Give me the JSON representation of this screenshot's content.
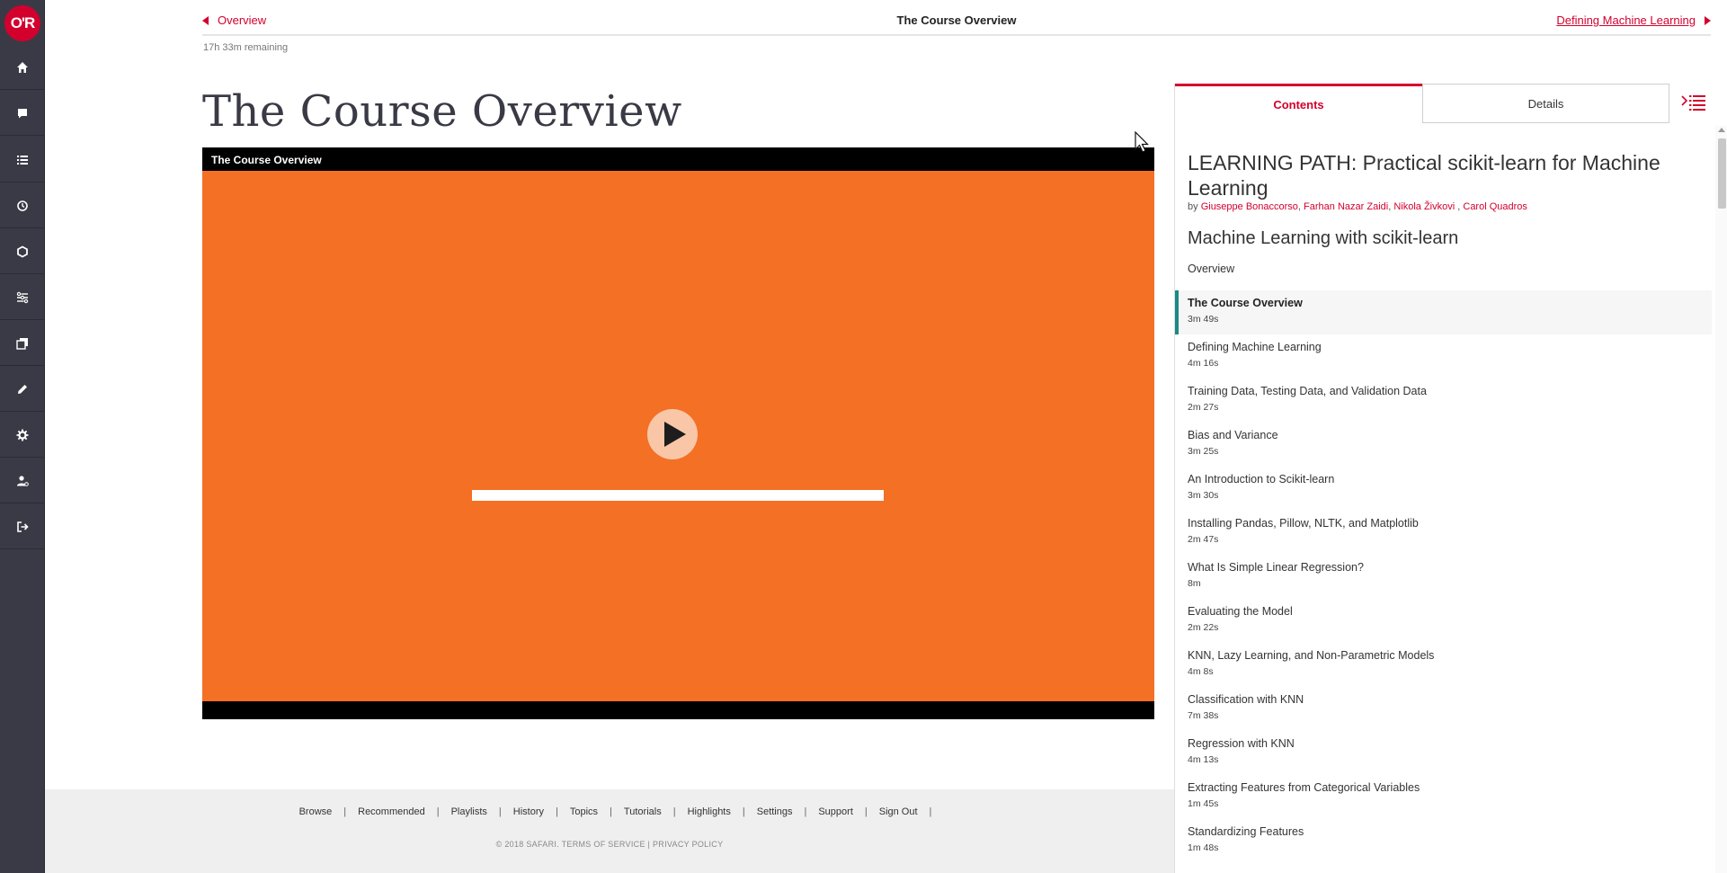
{
  "app": {
    "logo_text": "O'R",
    "brand_color": "#d3002d",
    "accent_color": "#1a8a83",
    "video_bg_color": "#f37024"
  },
  "sidebar": {
    "items": [
      {
        "name": "home",
        "icon": "home-icon"
      },
      {
        "name": "recommended",
        "icon": "chat-icon"
      },
      {
        "name": "playlists",
        "icon": "list-icon"
      },
      {
        "name": "history",
        "icon": "history-icon"
      },
      {
        "name": "topics",
        "icon": "hexagon-icon"
      },
      {
        "name": "tutorials",
        "icon": "tutorials-icon"
      },
      {
        "name": "highlights",
        "icon": "copy-icon"
      },
      {
        "name": "notes",
        "icon": "pencil-icon"
      },
      {
        "name": "settings",
        "icon": "gear-icon"
      },
      {
        "name": "account",
        "icon": "user-icon"
      },
      {
        "name": "sign-out",
        "icon": "sign-out-icon"
      }
    ]
  },
  "topbar": {
    "prev_label": "Overview",
    "title": "The Course Overview",
    "next_label": "Defining Machine Learning"
  },
  "remaining": "17h 33m remaining",
  "page_title": "The Course Overview",
  "video": {
    "title": "The Course Overview",
    "play_icon": "play-icon",
    "progress": 0
  },
  "footer": {
    "links": [
      "Browse",
      "Recommended",
      "Playlists",
      "History",
      "Topics",
      "Tutorials",
      "Highlights",
      "Settings",
      "Support",
      "Sign Out"
    ],
    "copyright": "© 2018 SAFARI. TERMS OF SERVICE | PRIVACY POLICY"
  },
  "panel": {
    "tabs": {
      "contents": "Contents",
      "details": "Details"
    },
    "toc_icon": "toc-icon",
    "path_title": "LEARNING PATH: Practical scikit-learn for Machine Learning",
    "by_label": "by",
    "authors": [
      "Giuseppe Bonaccorso",
      "Farhan Nazar Zaidi",
      "Nikola Živkovi",
      "Carol Quadros"
    ],
    "course_title": "Machine Learning with scikit-learn",
    "overview_label": "Overview",
    "lessons": [
      {
        "title": "The Course Overview",
        "duration": "3m 49s",
        "active": true
      },
      {
        "title": "Defining Machine Learning",
        "duration": "4m 16s"
      },
      {
        "title": "Training Data, Testing Data, and Validation Data",
        "duration": "2m 27s"
      },
      {
        "title": "Bias and Variance",
        "duration": "3m 25s"
      },
      {
        "title": "An Introduction to Scikit-learn",
        "duration": "3m 30s"
      },
      {
        "title": "Installing Pandas, Pillow, NLTK, and Matplotlib",
        "duration": "2m 47s"
      },
      {
        "title": "What Is Simple Linear Regression?",
        "duration": "8m"
      },
      {
        "title": "Evaluating the Model",
        "duration": "2m 22s"
      },
      {
        "title": "KNN, Lazy Learning, and Non-Parametric Models",
        "duration": "4m 8s"
      },
      {
        "title": "Classification with KNN",
        "duration": "7m 38s"
      },
      {
        "title": "Regression with KNN",
        "duration": "4m 13s"
      },
      {
        "title": "Extracting Features from Categorical Variables",
        "duration": "1m 45s"
      },
      {
        "title": "Standardizing Features",
        "duration": "1m 48s"
      }
    ]
  }
}
